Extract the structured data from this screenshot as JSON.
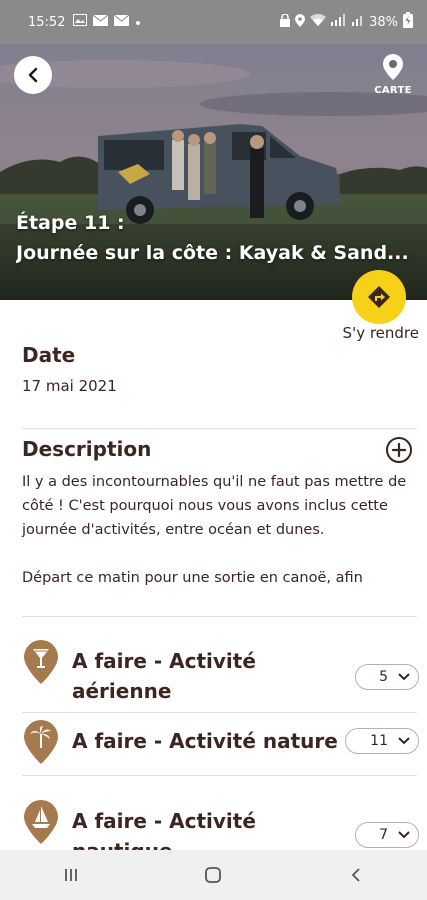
{
  "status_bar": {
    "time": "15:52",
    "battery": "38%"
  },
  "hero": {
    "map_label": "CARTE",
    "title_line1": "Étape  11 :",
    "title_line2": "Journée sur la côte : Kayak & Sand..."
  },
  "go": {
    "label": "S'y rendre"
  },
  "date": {
    "title": "Date",
    "value": "17 mai 2021"
  },
  "description": {
    "title": "Description",
    "paragraph1": "Il y a des incontournables qu'il ne faut pas mettre de côté ! C'est pourquoi nous vous avons inclus cette journée d'activités, entre océan et dunes.",
    "paragraph2": "Départ ce matin pour une sortie en canoë, afin"
  },
  "activities": [
    {
      "label": "A faire - Activité aérienne",
      "count": "5",
      "icon": "cocktail-icon"
    },
    {
      "label": "A faire - Activité nature",
      "count": "11",
      "icon": "palm-tree-icon"
    },
    {
      "label": "A faire - Activité nautique",
      "count": "7",
      "icon": "sailboat-icon"
    }
  ],
  "colors": {
    "brand_brown": "#3b2620",
    "pin_brown": "#a57a4e",
    "accent_yellow": "#f7d117"
  }
}
